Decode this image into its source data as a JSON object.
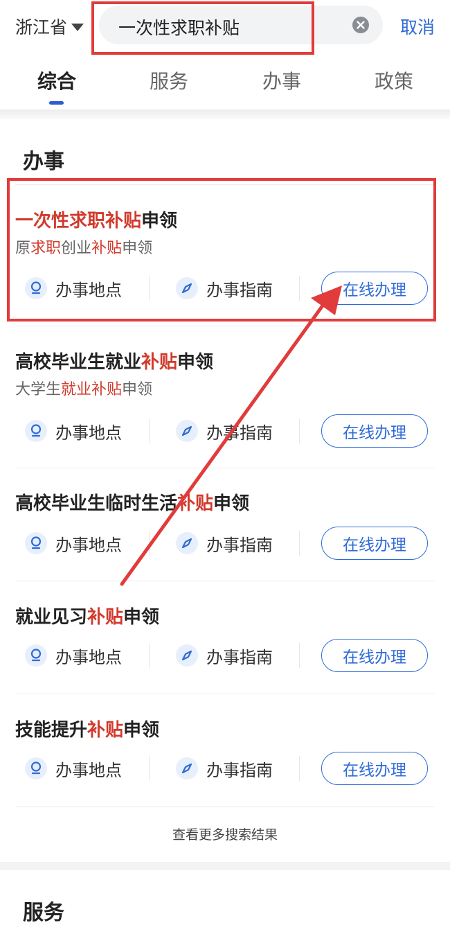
{
  "header": {
    "region": "浙江省",
    "search_query": "一次性求职补贴",
    "cancel_label": "取消",
    "tabs": [
      {
        "label": "综合",
        "active": true
      },
      {
        "label": "服务",
        "active": false
      },
      {
        "label": "办事",
        "active": false
      },
      {
        "label": "政策",
        "active": false
      }
    ]
  },
  "section_affairs": {
    "title": "办事",
    "items": [
      {
        "title_parts": [
          "一次性求职补贴",
          "申领"
        ],
        "subtitle_parts": [
          "原",
          "求职",
          "创业",
          "补贴",
          "申领"
        ]
      },
      {
        "title_parts": [
          "高校毕业生就业",
          "补贴",
          "申领"
        ],
        "subtitle_parts": [
          "大学生",
          "就业补贴",
          "申领"
        ]
      },
      {
        "title_parts": [
          "高校毕业生临时生活",
          "补贴",
          "申领"
        ]
      },
      {
        "title_parts": [
          "就业见习",
          "补贴",
          "申领"
        ]
      },
      {
        "title_parts": [
          "技能提升",
          "补贴",
          "申领"
        ]
      }
    ],
    "location_label": "办事地点",
    "guide_label": "办事指南",
    "online_label": "在线办理",
    "more_label": "查看更多搜索结果"
  },
  "section_services": {
    "title": "服务"
  },
  "colors": {
    "accent_blue": "#2f6bd8",
    "highlight_red": "#d23a2c",
    "annotation_red": "#e23b3b"
  }
}
